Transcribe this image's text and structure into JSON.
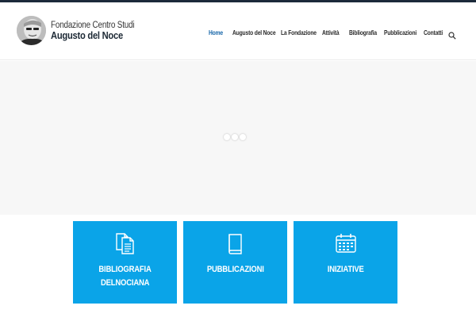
{
  "brand": {
    "line1": "Fondazione Centro Studi",
    "line2": "Augusto del Noce"
  },
  "nav": {
    "items": [
      "Home",
      "Augusto del Noce",
      "La Fondazione",
      "Attività",
      "Bibliografia",
      "Pubblicazioni",
      "Contatti"
    ],
    "active": "Home",
    "search_icon": "search-icon"
  },
  "hero": {
    "loader_icon": "loading-dots-icon"
  },
  "tiles": [
    {
      "line1": "BIBLIOGRAFIA",
      "line2": "DELNOCIANA",
      "icon": "documents-icon"
    },
    {
      "line1": "PUBBLICAZIONI",
      "line2": "",
      "icon": "book-icon"
    },
    {
      "line1": "INIZIATIVE",
      "line2": "",
      "icon": "calendar-icon"
    }
  ],
  "colors": {
    "accent": "#0aa4e8",
    "nav_active": "#1565a8",
    "top_strip": "#1c2a3a",
    "hero_bg": "#f7f7f7"
  }
}
